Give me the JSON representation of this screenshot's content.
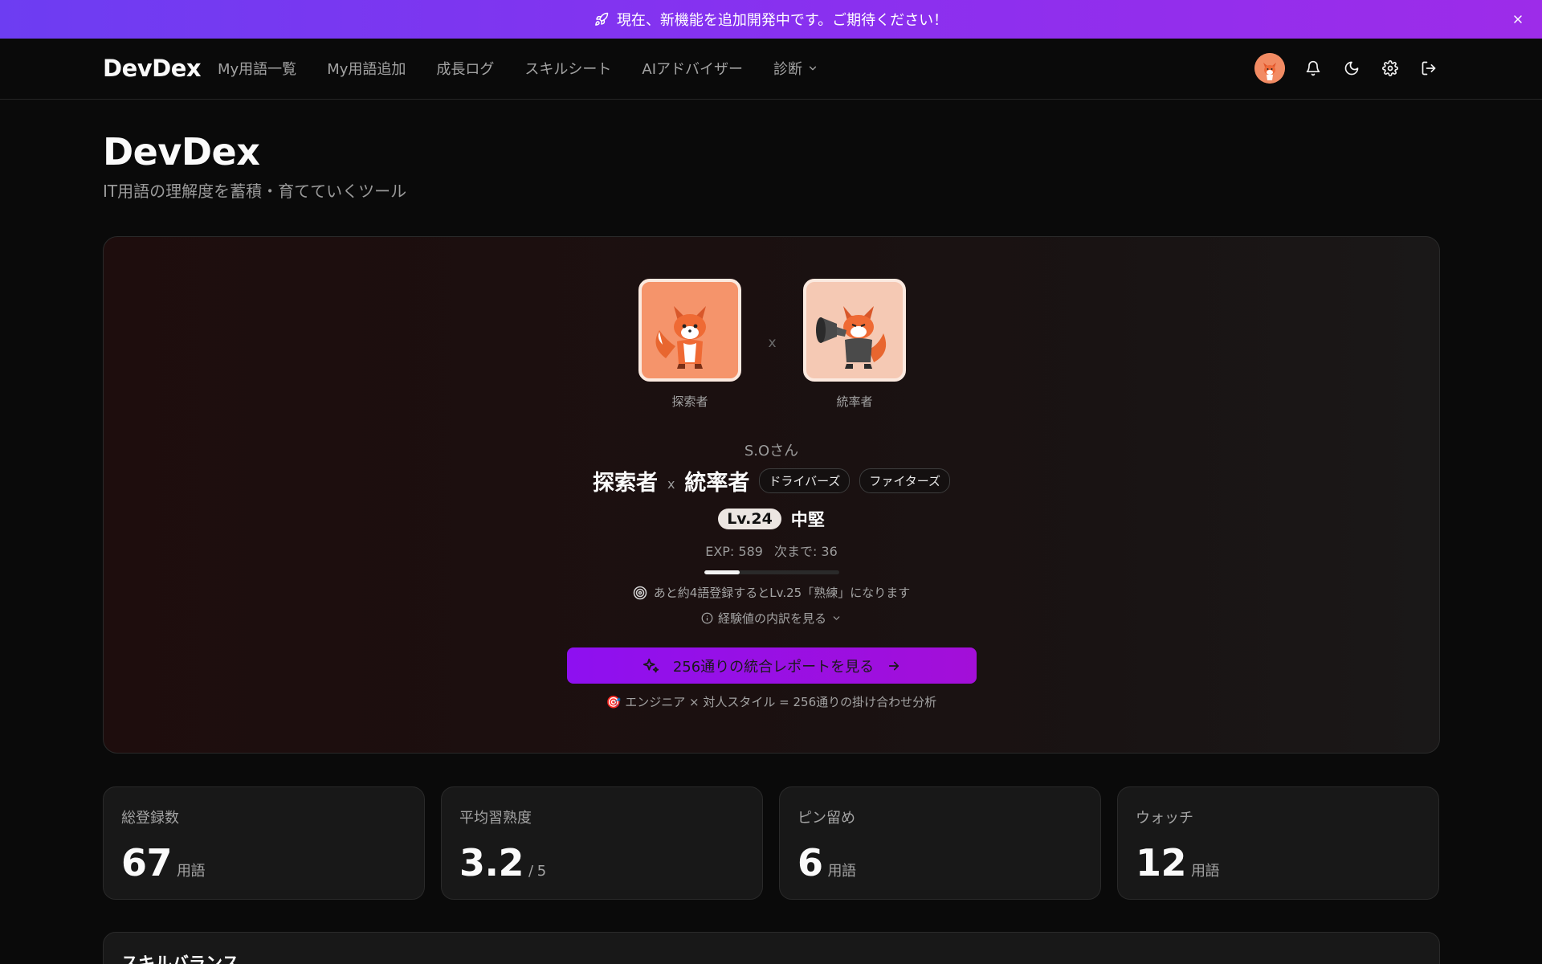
{
  "banner": {
    "text": "現在、新機能を追加開発中です。ご期待ください！"
  },
  "header": {
    "logo": "DevDex",
    "nav": [
      "My用語一覧",
      "My用語追加",
      "成長ログ",
      "スキルシート",
      "AIアドバイザー",
      "診断"
    ]
  },
  "page": {
    "title": "DevDex",
    "subtitle": "IT用語の理解度を蓄積・育てていくツール"
  },
  "hero": {
    "type1_label": "探索者",
    "type2_label": "統率者",
    "x_sep": "x",
    "username": "S.Oさん",
    "type1_name": "探索者",
    "type2_name": "統率者",
    "type_x": "x",
    "tags": [
      "ドライバーズ",
      "ファイターズ"
    ],
    "level": "Lv.24",
    "level_title": "中堅",
    "exp_text": "EXP: 589",
    "next_text": "次まで: 36",
    "progress": 0.26,
    "hint": "あと約4語登録するとLv.25「熟練」になります",
    "breakdown": "経験値の内訳を見る",
    "report_button": "256通りの統合レポートを見る",
    "report_note": "🎯 エンジニア × 対人スタイル = 256通りの掛け合わせ分析"
  },
  "stats": [
    {
      "label": "総登録数",
      "value": "67",
      "unit": "用語"
    },
    {
      "label": "平均習熟度",
      "value": "3.2",
      "unit": "/ 5"
    },
    {
      "label": "ピン留め",
      "value": "6",
      "unit": "用語"
    },
    {
      "label": "ウォッチ",
      "value": "12",
      "unit": "用語"
    }
  ],
  "skill": {
    "title": "スキルバランス"
  },
  "colors": {
    "banner_start": "#6d3df2",
    "banner_end": "#9d2ce9",
    "button": "#9a0fe4",
    "background": "#0a0a0a"
  },
  "icons": [
    "rocket-icon",
    "close-icon",
    "chevron-down-icon",
    "bell-icon",
    "moon-icon",
    "gear-icon",
    "logout-icon",
    "target-icon",
    "info-icon",
    "sparkle-icon",
    "arrow-right-icon"
  ]
}
